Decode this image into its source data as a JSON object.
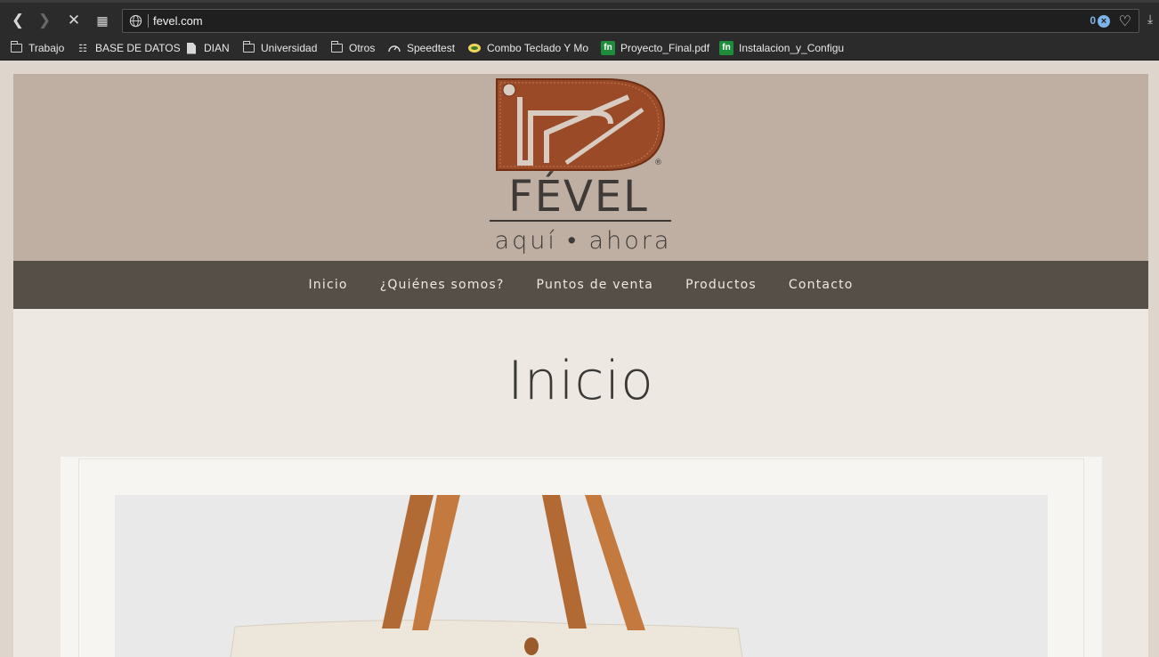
{
  "browser": {
    "url": "fevel.com",
    "blocked_count": "0",
    "bookmarks": [
      {
        "label": "Trabajo",
        "icon": "folder-icon"
      },
      {
        "label": "BASE DE DATOS",
        "icon": "database-icon"
      },
      {
        "label": "DIAN",
        "icon": "document-icon"
      },
      {
        "label": "Universidad",
        "icon": "folder-icon"
      },
      {
        "label": "Otros",
        "icon": "folder-icon"
      },
      {
        "label": "Speedtest",
        "icon": "speedometer-icon"
      },
      {
        "label": "Combo Teclado Y Mo",
        "icon": "store-icon"
      },
      {
        "label": "Proyecto_Final.pdf",
        "icon": "fn-icon"
      },
      {
        "label": "Instalacion_y_Configu",
        "icon": "fn-icon"
      }
    ]
  },
  "site": {
    "brand": "FÉVEL",
    "tagline": "aquí • ahora",
    "registered_mark": "®",
    "nav": [
      "Inicio",
      "¿Quiénes somos?",
      "Puntos de venta",
      "Productos",
      "Contacto"
    ],
    "page_title": "Inicio"
  },
  "colors": {
    "header_bg": "#bfafa2",
    "nav_bg": "#554f47",
    "content_bg": "#ede8e1",
    "leather_brown": "#9b4a28"
  }
}
